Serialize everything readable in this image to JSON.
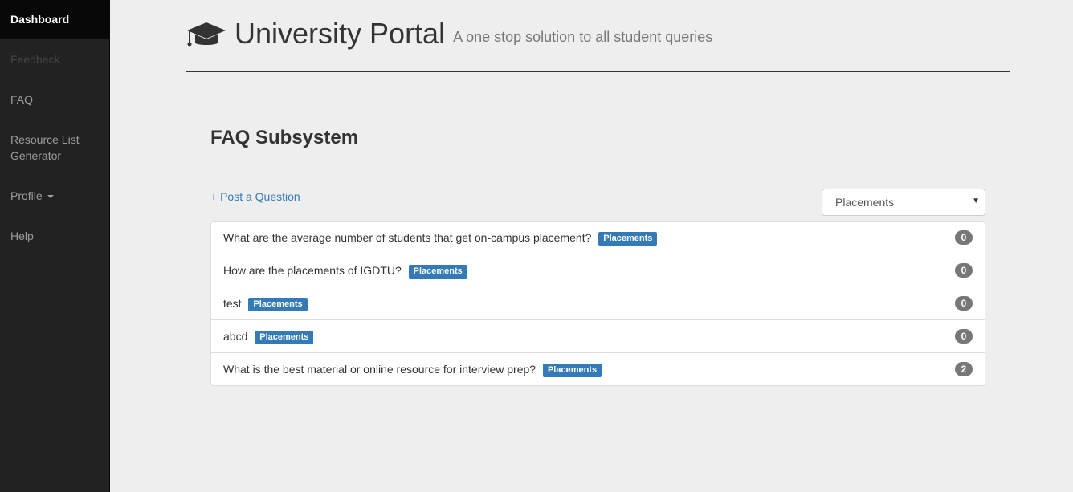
{
  "sidebar": {
    "items": [
      {
        "label": "Dashboard"
      },
      {
        "label": "Feedback"
      },
      {
        "label": "FAQ"
      },
      {
        "label": "Resource List"
      },
      {
        "label": "Generator"
      },
      {
        "label": "Profile"
      },
      {
        "label": "Help"
      }
    ]
  },
  "header": {
    "icon": "graduation-cap-icon",
    "title": "University Portal",
    "subtitle": "A one stop solution to all student queries"
  },
  "main": {
    "section_title": "FAQ Subsystem",
    "post_link": "+ Post a Question",
    "category_select": "Placements",
    "questions": [
      {
        "text": "What are the average number of students that get on-campus placement?",
        "tag": "Placements",
        "count": "0"
      },
      {
        "text": "How are the placements of IGDTU?",
        "tag": "Placements",
        "count": "0"
      },
      {
        "text": "test",
        "tag": "Placements",
        "count": "0"
      },
      {
        "text": "abcd",
        "tag": "Placements",
        "count": "0"
      },
      {
        "text": "What is the best material or online resource for interview prep?",
        "tag": "Placements",
        "count": "2"
      }
    ]
  },
  "colors": {
    "sidebar_bg": "#222222",
    "accent": "#337ab7",
    "page_bg": "#eeeeee",
    "badge": "#777777"
  }
}
